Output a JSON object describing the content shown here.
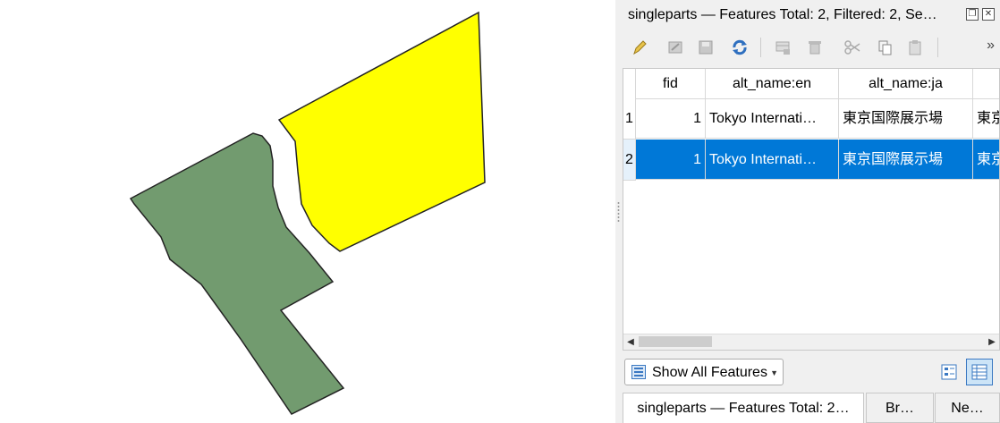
{
  "window": {
    "title": "singleparts — Features Total: 2, Filtered: 2, Se…"
  },
  "map": {
    "polygons": [
      {
        "name": "green-parcel",
        "fill": "#729b6f",
        "stroke": "#232323"
      },
      {
        "name": "yellow-parcel",
        "fill": "#ffff00",
        "stroke": "#232323"
      }
    ]
  },
  "toolbar": {
    "buttons": [
      {
        "name": "toggle-editing-icon"
      },
      {
        "name": "multi-edit-icon"
      },
      {
        "name": "save-edits-icon"
      },
      {
        "name": "reload-icon"
      },
      {
        "name": "add-feature-icon"
      },
      {
        "name": "delete-feature-icon"
      },
      {
        "name": "cut-icon"
      },
      {
        "name": "copy-icon"
      },
      {
        "name": "paste-icon"
      }
    ],
    "more": "»"
  },
  "table": {
    "columns": [
      "fid",
      "alt_name:en",
      "alt_name:ja",
      ""
    ],
    "rows": [
      {
        "num": "1",
        "fid": "1",
        "en": "Tokyo Internati…",
        "ja": "東京国際展示場",
        "extra": "東京"
      },
      {
        "num": "2",
        "fid": "1",
        "en": "Tokyo Internati…",
        "ja": "東京国際展示場",
        "extra": "東京"
      }
    ],
    "selected_row": 2
  },
  "bottom": {
    "show_all_label": "Show All Features"
  },
  "tabs": [
    {
      "label": "singleparts — Features Total: 2…"
    },
    {
      "label": "Br…"
    },
    {
      "label": "Ne…"
    }
  ],
  "colors": {
    "selection": "#0078d7",
    "accent": "#3a78c2"
  }
}
